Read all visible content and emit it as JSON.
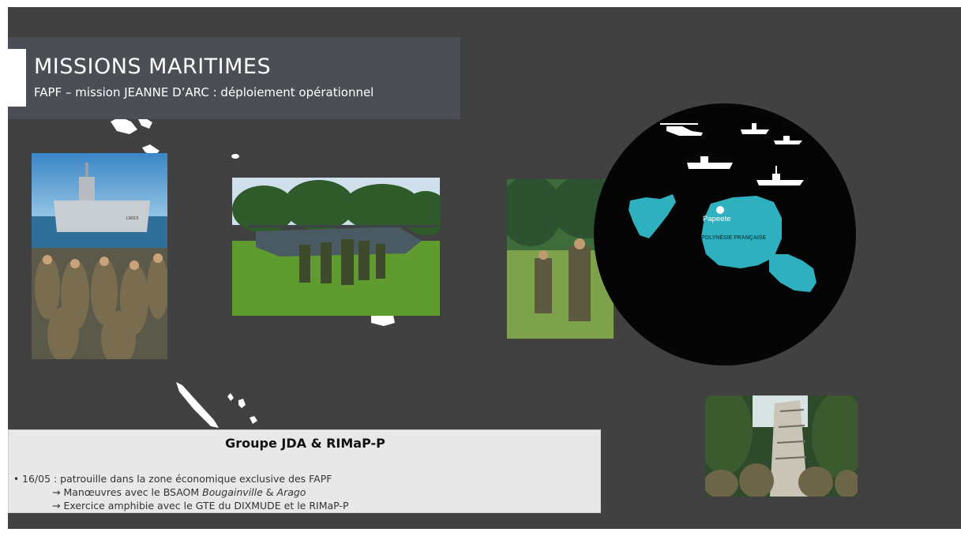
{
  "title": {
    "main": "MISSIONS MARITIMES",
    "subtitle": "FAPF – mission  JEANNE D’ARC : déploiement opérationnel"
  },
  "map": {
    "place_label": "Papeete",
    "region_label": "POLYNÉSIE FRANÇAISE",
    "island_color": "#2fb0bf",
    "circle_color": "#050505",
    "icons": [
      "helicopter-icon",
      "ship-icon",
      "ship-icon",
      "ship-icon",
      "ship-icon"
    ]
  },
  "photos": {
    "ship_hull_marking": "L9015"
  },
  "caption": {
    "heading": "Groupe JDA & RIMaP-P",
    "bullet_marker": "•",
    "line1": "16/05 : patrouille dans la zone économique exclusive des FAPF",
    "line2_prefix": "→ Manœuvres avec le BSAOM ",
    "line2_ship1": "Bougainville",
    "line2_sep": " & ",
    "line2_ship2": "Arago",
    "line3": "→ Exercice amphibie avec le GTE du DIXMUDE et le RIMaP-P"
  },
  "colors": {
    "background": "#414141",
    "title_band": "#4b4f55",
    "caption_box": "#e8e8e8",
    "accent_island": "#2fb0bf"
  }
}
